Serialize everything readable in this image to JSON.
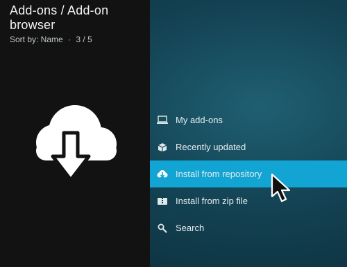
{
  "header": {
    "title": "Add-ons / Add-on browser",
    "sort_label": "Sort by: Name",
    "separator": "·",
    "position": "3 / 5"
  },
  "menu": {
    "items": [
      {
        "label": "My add-ons",
        "icon": "monitor-icon"
      },
      {
        "label": "Recently updated",
        "icon": "box-icon"
      },
      {
        "label": "Install from repository",
        "icon": "cloud-download-icon",
        "active": true
      },
      {
        "label": "Install from zip file",
        "icon": "zip-icon"
      },
      {
        "label": "Search",
        "icon": "search-icon"
      }
    ]
  },
  "colors": {
    "accent": "#12a4d3",
    "left_panel": "#121212",
    "background": "#134253"
  }
}
